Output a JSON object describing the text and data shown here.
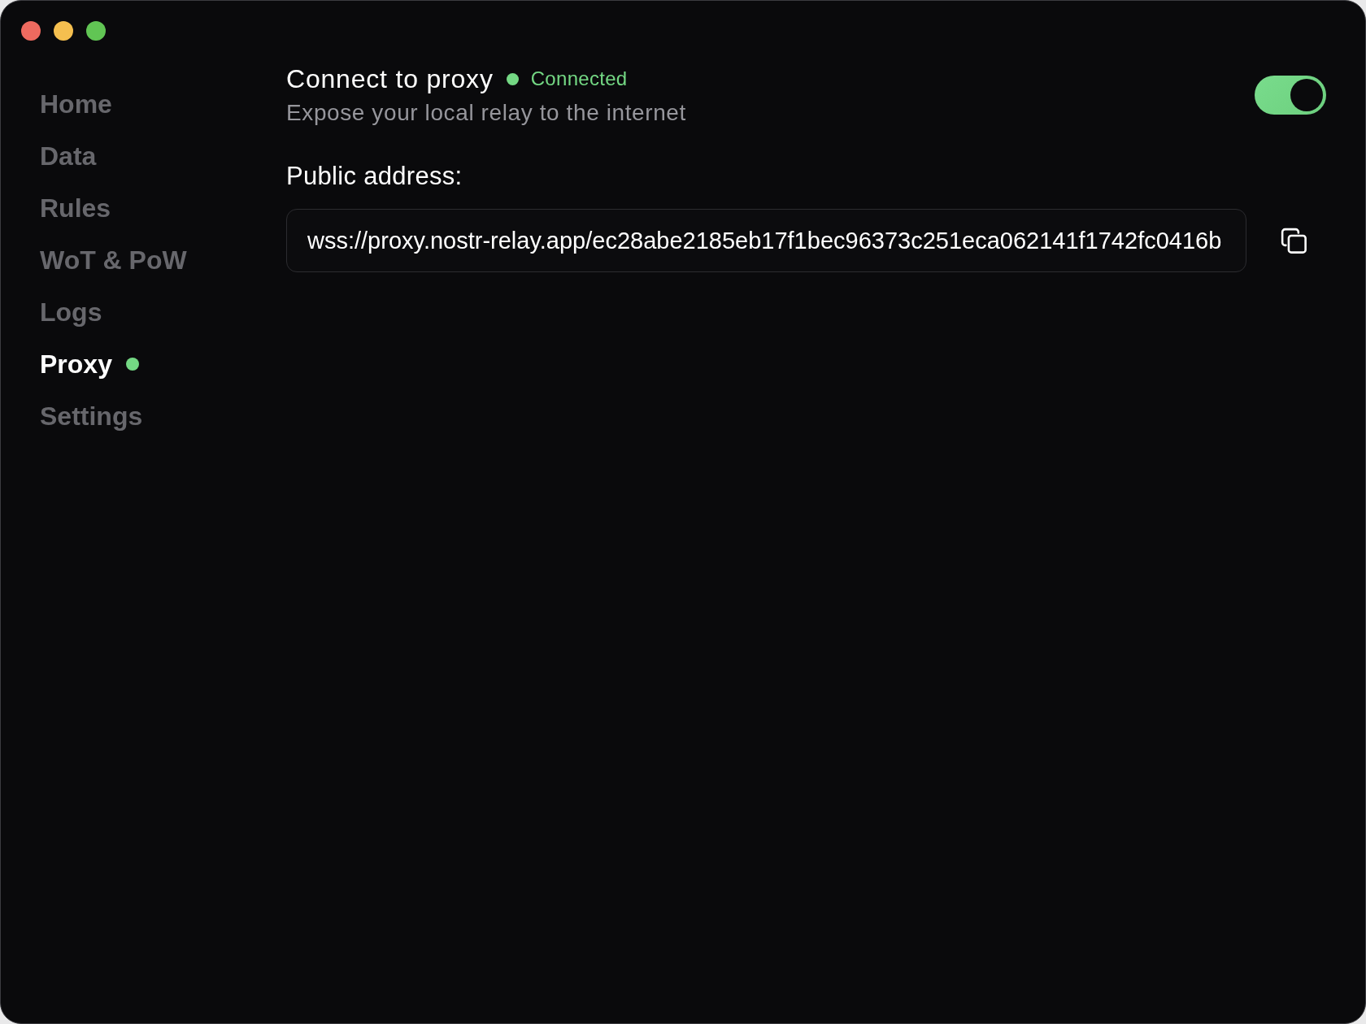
{
  "sidebar": {
    "items": [
      {
        "label": "Home",
        "selected": false
      },
      {
        "label": "Data",
        "selected": false
      },
      {
        "label": "Rules",
        "selected": false
      },
      {
        "label": "WoT & PoW",
        "selected": false
      },
      {
        "label": "Logs",
        "selected": false
      },
      {
        "label": "Proxy",
        "selected": true,
        "color": "#74d884"
      },
      {
        "label": "Settings",
        "selected": false
      }
    ]
  },
  "proxy": {
    "title": "Connect to proxy",
    "status": {
      "label": "Connected",
      "color": "#74d884"
    },
    "subtitle": "Expose your local relay to the internet",
    "toggle": {
      "on": true
    }
  },
  "public_address": {
    "label": "Public address:",
    "value": "wss://proxy.nostr-relay.app/ec28abe2185eb17f1bec96373c251eca062141f1742fc0416b"
  }
}
